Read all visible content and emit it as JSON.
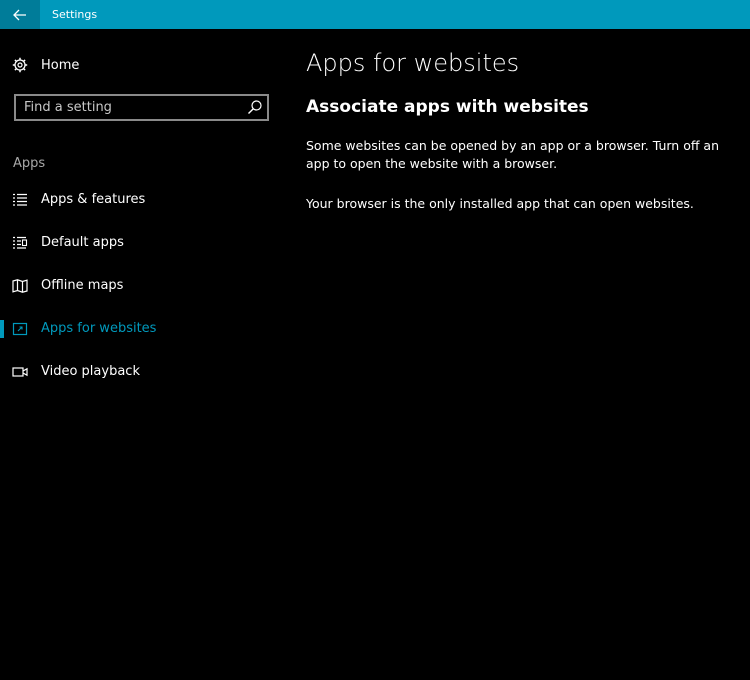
{
  "window": {
    "title": "Settings"
  },
  "sidebar": {
    "home_label": "Home",
    "search_placeholder": "Find a setting",
    "section_label": "Apps",
    "items": [
      {
        "label": "Apps & features",
        "icon": "list-icon",
        "selected": false
      },
      {
        "label": "Default apps",
        "icon": "default-apps-icon",
        "selected": false
      },
      {
        "label": "Offline maps",
        "icon": "map-icon",
        "selected": false
      },
      {
        "label": "Apps for websites",
        "icon": "website-app-icon",
        "selected": true
      },
      {
        "label": "Video playback",
        "icon": "video-icon",
        "selected": false
      }
    ]
  },
  "main": {
    "title": "Apps for websites",
    "subtitle": "Associate apps with websites",
    "description": "Some websites can be opened by an app or a browser.  Turn off an app to open the website with a browser.",
    "status": "Your browser is the only installed app that can open websites."
  },
  "colors": {
    "accent": "#0099bc",
    "titlebar": "#0099bc",
    "background": "#000000"
  }
}
